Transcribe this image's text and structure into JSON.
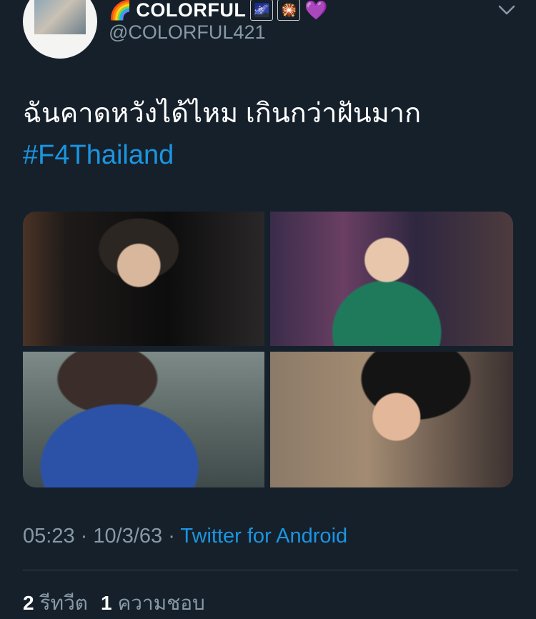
{
  "tweet": {
    "display_name": "COLORFUL",
    "name_emojis": {
      "rainbow": "🌈",
      "milky_way": "🌌",
      "fireworks": "🎇",
      "purple_heart": "💜"
    },
    "handle": "@COLORFUL421",
    "text": "ฉันคาดหวังได้ไหม เกินกว่าฝันมาก",
    "hashtag": "#F4Thailand",
    "media": [
      {
        "icon": "photo-1"
      },
      {
        "icon": "photo-2"
      },
      {
        "icon": "photo-3"
      },
      {
        "icon": "photo-4"
      }
    ],
    "time": "05:23",
    "date": "10/3/63",
    "separator": "·",
    "source": "Twitter for Android",
    "retweets_count": "2",
    "retweets_label": "รีทวีต",
    "likes_count": "1",
    "likes_label": "ความชอบ"
  },
  "colors": {
    "background": "#15202b",
    "text": "#ffffff",
    "secondary": "#8899a6",
    "link": "#1b95e0",
    "divider": "#38444d"
  }
}
